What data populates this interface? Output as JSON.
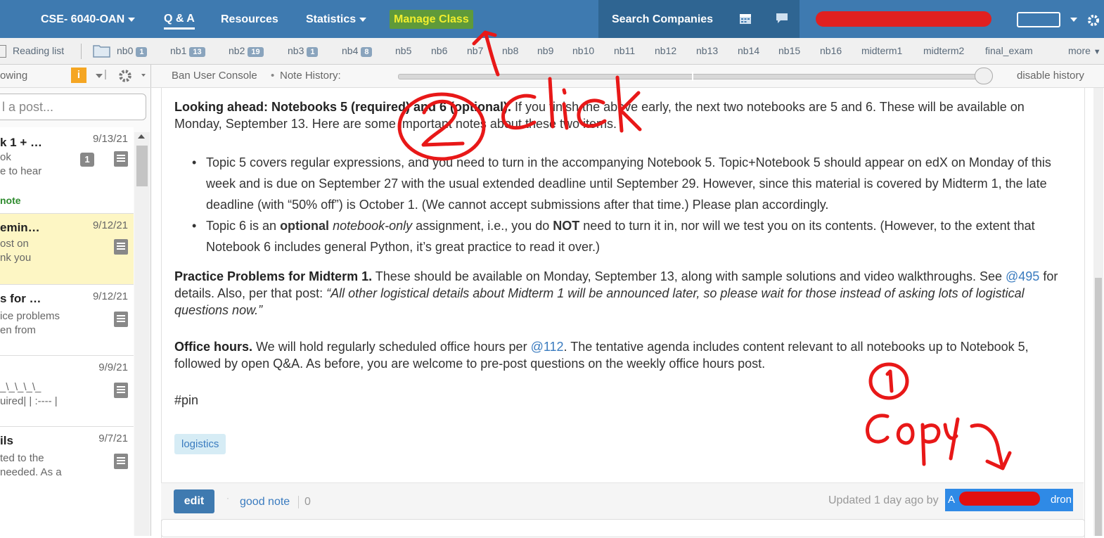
{
  "nav": {
    "course": "CSE- 6040-OAN",
    "qa": "Q & A",
    "resources": "Resources",
    "statistics": "Statistics",
    "manage": "Manage Class",
    "search_companies": "Search Companies"
  },
  "folders": {
    "reading_list": "Reading list",
    "items": [
      {
        "label": "nb0",
        "count": "1"
      },
      {
        "label": "nb1",
        "count": "13"
      },
      {
        "label": "nb2",
        "count": "19"
      },
      {
        "label": "nb3",
        "count": "1"
      },
      {
        "label": "nb4",
        "count": "8"
      },
      {
        "label": "nb5",
        "count": ""
      },
      {
        "label": "nb6",
        "count": ""
      },
      {
        "label": "nb7",
        "count": ""
      },
      {
        "label": "nb8",
        "count": ""
      },
      {
        "label": "nb9",
        "count": ""
      },
      {
        "label": "nb10",
        "count": ""
      },
      {
        "label": "nb11",
        "count": ""
      },
      {
        "label": "nb12",
        "count": ""
      },
      {
        "label": "nb13",
        "count": ""
      },
      {
        "label": "nb14",
        "count": ""
      },
      {
        "label": "nb15",
        "count": ""
      },
      {
        "label": "nb16",
        "count": ""
      },
      {
        "label": "midterm1",
        "count": ""
      },
      {
        "label": "midterm2",
        "count": ""
      },
      {
        "label": "final_exam",
        "count": ""
      }
    ],
    "more": "more"
  },
  "subbar": {
    "following": "owing",
    "ban_console": "Ban User Console",
    "note_history": "Note History:",
    "disable_history": "disable history"
  },
  "sidebar": {
    "search_placeholder": "l a post...",
    "posts": [
      {
        "title": "k 1 + …",
        "date": "9/13/21",
        "line1": "ok",
        "line2": "e to hear",
        "note": "note",
        "count": "1"
      },
      {
        "title": "emin…",
        "date": "9/12/21",
        "line1": "ost on",
        "line2": "nk you"
      },
      {
        "title": "s for …",
        "date": "9/12/21",
        "line1": "ice problems",
        "line2": "en from"
      },
      {
        "title": "",
        "date": "9/9/21",
        "line1": "_\\_\\_\\_\\_",
        "line2": "uired| | :---- |"
      },
      {
        "title": "ils",
        "date": "9/7/21",
        "line1": "ted to the",
        "line2": "needed. As a"
      }
    ]
  },
  "post": {
    "p1_bold": "Looking ahead: Notebooks 5 (required) and 6 (optional).",
    "p1_text": " If you finish the above early, the next two notebooks are 5 and 6. These will be available on Monday, September 13. Here are some important notes about these two items.",
    "b1": "Topic 5 covers regular expressions, and you need to turn in the accompanying Notebook 5. Topic+Notebook 5 should appear on edX on Monday of this week and is due on September 27 with the usual extended deadline until September 29. However, since this material is covered by Midterm 1, the late deadline (with “50% off”) is October 1. (We cannot accept submissions after that time.) Please plan accordingly.",
    "b2_a": "Topic 6 is an ",
    "b2_optional": "optional",
    "b2_nb": "notebook-only",
    "b2_b": " assignment, i.e., you do ",
    "b2_not": "NOT",
    "b2_c": " need to turn it in, nor will we test you on its contents. (However, to the extent that Notebook 6 includes general Python, it’s great practice to read it over.)",
    "p2_bold": "Practice Problems for Midterm 1.",
    "p2_text": " These should be available on Monday, September 13, along with sample solutions and video walkthroughs. See ",
    "p2_link": "@495",
    "p2_text2": " for details. Also, per that post: ",
    "p2_quote": "“All other logistical details about Midterm 1 will be announced later, so please wait for those instead of asking lots of logistical questions now.”",
    "p3_bold": "Office hours.",
    "p3_text": " We will hold regularly scheduled office hours per ",
    "p3_link": "@112",
    "p3_text2": ". The tentative agenda includes content relevant to all notebooks up to Notebook 5, followed by open Q&A. As before, you are welcome to pre-post questions on the weekly office hours post.",
    "pin": "#pin",
    "tag": "logistics"
  },
  "footer": {
    "edit": "edit",
    "good_note": "good note",
    "good_count": "0",
    "updated": "Updated 1 day ago by",
    "author_prefix": "A",
    "author_suffix": "dron"
  },
  "annotations": {
    "click": "click",
    "num2": "2",
    "num1": "1",
    "copy": "Copy"
  },
  "colors": {
    "nav_bg": "#3e7ab0",
    "manage_bg": "#5f9a3a",
    "manage_text": "#f1ee2e",
    "annotation": "#e81818"
  }
}
